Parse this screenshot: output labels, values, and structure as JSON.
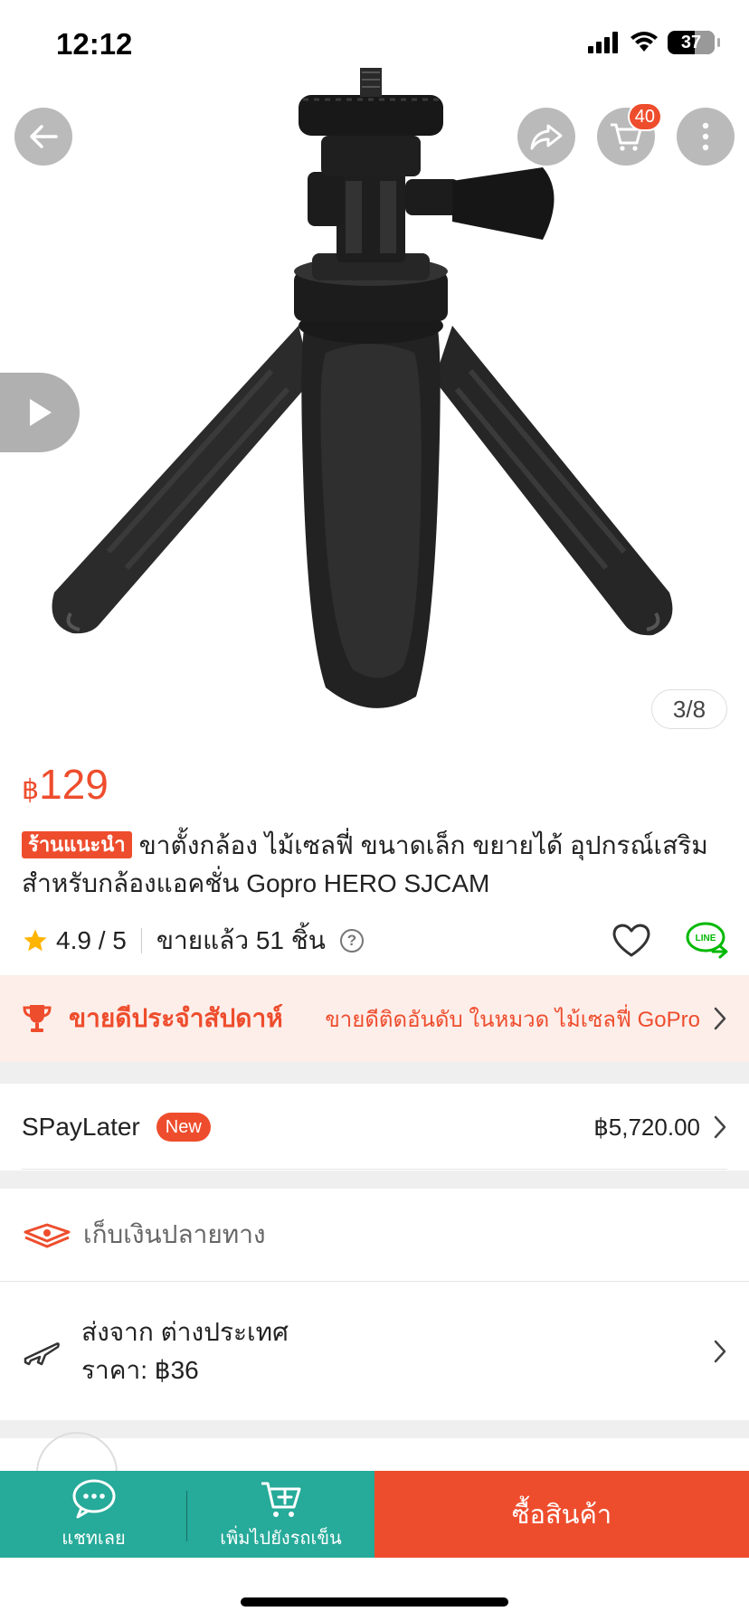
{
  "status_bar": {
    "time": "12:12",
    "battery": "37"
  },
  "header": {
    "cart_count": "40"
  },
  "gallery": {
    "counter": "3/8"
  },
  "product": {
    "currency": "฿",
    "price": "129",
    "shop_tag": "ร้านแนะนำ",
    "title": "ขาตั้งกล้อง ไม้เซลฟี่ ขนาดเล็ก ขยายได้ อุปกรณ์เสริม สำหรับกล้องแอคชั่น Gopro HERO SJCAM",
    "rating": "4.9 / 5",
    "sold": "ขายแล้ว 51 ชิ้น",
    "help": "?",
    "line_label": "LINE"
  },
  "best_seller": {
    "title": "ขายดีประจำสัปดาห์",
    "subtitle": "ขายดีติดอันดับ ในหมวด ไม้เซลฟี่ GoPro"
  },
  "spaylater": {
    "label": "SPayLater",
    "badge": "New",
    "amount": "฿5,720.00"
  },
  "cod": {
    "label": "เก็บเงินปลายทาง"
  },
  "shipping": {
    "from": "ส่งจาก ต่างประเทศ",
    "price": "ราคา: ฿36"
  },
  "bottom_bar": {
    "chat": "แชทเลย",
    "add_to_cart": "เพิ่มไปยังรถเข็น",
    "buy": "ซื้อสินค้า"
  },
  "colors": {
    "brand": "#ee4d2d",
    "teal": "#26aa99",
    "star": "#ffb400",
    "line_green": "#00b900"
  },
  "icons": [
    "back-arrow-icon",
    "share-icon",
    "cart-icon",
    "more-icon",
    "play-icon",
    "star-icon",
    "heart-icon",
    "line-share-icon",
    "trophy-icon",
    "cash-icon",
    "plane-icon",
    "chat-icon",
    "cart-plus-icon",
    "chevron-right-icon"
  ]
}
